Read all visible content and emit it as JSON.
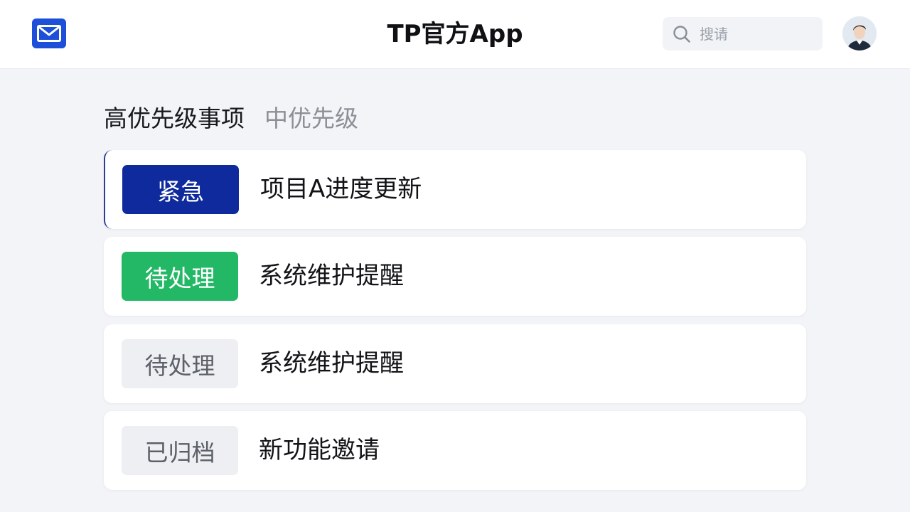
{
  "header": {
    "title": "TP官方App",
    "search_placeholder": "搜请",
    "mail_icon": "mail-icon",
    "search_icon": "search-icon",
    "avatar": "user-avatar"
  },
  "tabs": [
    {
      "label": "高优先级事项",
      "active": true
    },
    {
      "label": "中优先级",
      "active": false
    }
  ],
  "items": [
    {
      "badge": "紧急",
      "title": "项目A进度更新",
      "badge_bg": "#0f2a9c",
      "badge_fg": "#ffffff"
    },
    {
      "badge": "待处理",
      "title": "系统维护提醒",
      "badge_bg": "#22b865",
      "badge_fg": "#ffffff"
    },
    {
      "badge": "待处理",
      "title": "系统维护提醒",
      "badge_bg": "#eeeff2",
      "badge_fg": "#5c6068"
    },
    {
      "badge": "已归档",
      "title": "新功能邀请",
      "badge_bg": "#eeeff2",
      "badge_fg": "#5c6068"
    }
  ],
  "colors": {
    "accent": "#1d4fd8",
    "background": "#f3f4f7"
  }
}
